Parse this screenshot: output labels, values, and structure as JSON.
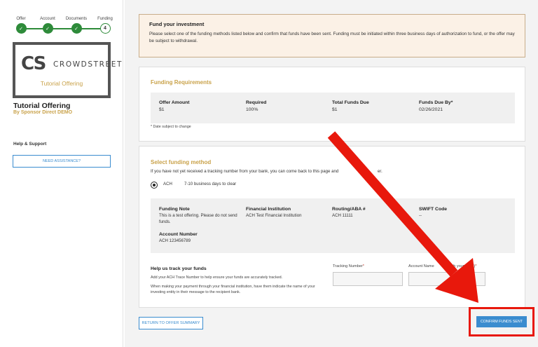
{
  "stepper": {
    "steps": [
      {
        "label": "Offer",
        "state": "done",
        "mark": "✓"
      },
      {
        "label": "Account",
        "state": "done",
        "mark": "✓"
      },
      {
        "label": "Documents",
        "state": "done",
        "mark": "✓"
      },
      {
        "label": "Funding",
        "state": "current",
        "mark": "4"
      }
    ],
    "accent_color": "#2e8b3a"
  },
  "sidebar": {
    "logo_mark": "CS",
    "logo_name": "CROWDSTREET",
    "logo_subtitle": "Tutorial Offering",
    "offering_title": "Tutorial Offering",
    "offering_sponsor": "By Sponsor Direct DEMO",
    "help_title": "Help & Support",
    "assist_button": "NEED ASSISTANCE?"
  },
  "notice": {
    "title": "Fund your investment",
    "body": "Please select one of the funding methods listed below and confirm that funds have been sent. Funding must be initiated within three business days of authorization to fund, or the offer may be subject to withdrawal."
  },
  "requirements": {
    "title": "Funding Requirements",
    "columns": [
      {
        "header": "Offer Amount",
        "value": "$1"
      },
      {
        "header": "Required",
        "value": "100%"
      },
      {
        "header": "Total Funds Due",
        "value": "$1"
      },
      {
        "header": "Funds Due By*",
        "value": "02/26/2021"
      }
    ],
    "footnote": "* Date subject to change"
  },
  "funding_method": {
    "title": "Select funding method",
    "instructions": "If you have not yet received a tracking number from your bank, you can come back to this page and",
    "instructions_tail": "er.",
    "option_label": "ACH",
    "option_detail": "7-10 business days to clear",
    "details": {
      "note_header": "Funding Note",
      "note_value": "This is a test offering. Please do not send funds.",
      "institution_header": "Financial Institution",
      "institution_value": "ACH Test Financial Institution",
      "routing_header": "Routing/ABA #",
      "routing_value": "ACH 11111",
      "swift_header": "SWIFT Code",
      "swift_value": "--",
      "account_header": "Account Number",
      "account_value": "ACH 123456789"
    },
    "tracking": {
      "title": "Help us track your funds",
      "line1": "Add your ACH Trace Number to help ensure your funds are accurately tracked.",
      "line2": "When making your payment through your financial institution, have them indicate the name of your investing entity in their message to the recipient bank.",
      "tracking_label": "Tracking Number",
      "account_label_a": "Account Name",
      "account_label_b": "d with your bank)",
      "required_mark": "*",
      "tracking_value": "",
      "account_value": ""
    }
  },
  "actions": {
    "return_button": "RETURN TO OFFER SUMMARY",
    "confirm_button": "CONFIRM FUNDS SENT"
  },
  "colors": {
    "brand_gold": "#c9a24a",
    "button_blue": "#3a8ccf",
    "annotation_red": "#e8180c"
  }
}
